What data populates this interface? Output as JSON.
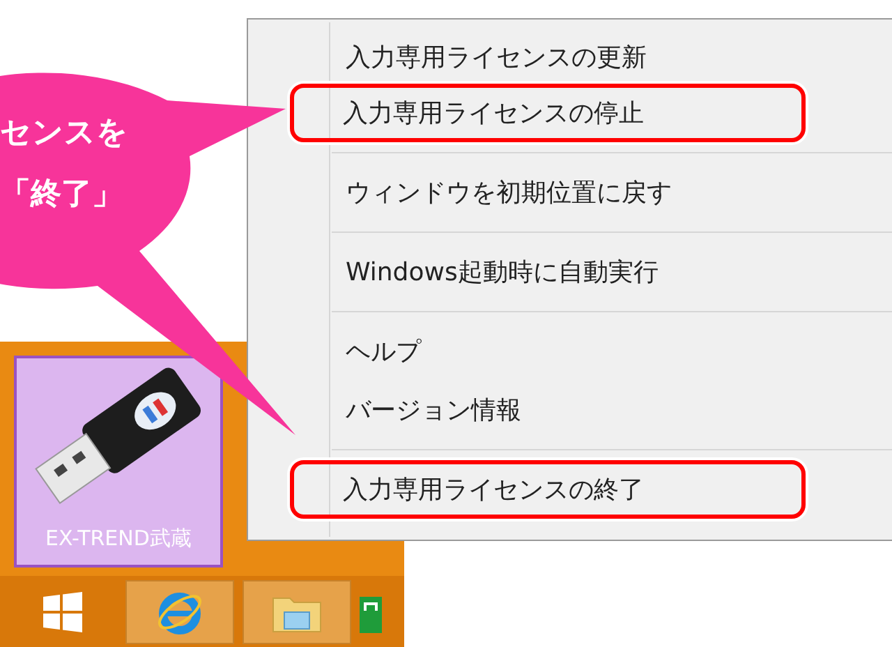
{
  "callout": {
    "lines": [
      "センスを",
      "「終了」"
    ]
  },
  "desktop_tile": {
    "label": "EX-TREND武蔵"
  },
  "context_menu": {
    "items": [
      {
        "label": "入力専用ライセンスの更新",
        "highlighted": false,
        "separator_after": false
      },
      {
        "label": "入力専用ライセンスの停止",
        "highlighted": true,
        "separator_after": true
      },
      {
        "label": "ウィンドウを初期位置に戻す",
        "highlighted": false,
        "separator_after": true
      },
      {
        "label": "Windows起動時に自動実行",
        "highlighted": false,
        "separator_after": true
      },
      {
        "label": "ヘルプ",
        "highlighted": false,
        "separator_after": false
      },
      {
        "label": "バージョン情報",
        "highlighted": false,
        "separator_after": true
      },
      {
        "label": "入力専用ライセンスの終了",
        "highlighted": true,
        "separator_after": false
      }
    ]
  }
}
